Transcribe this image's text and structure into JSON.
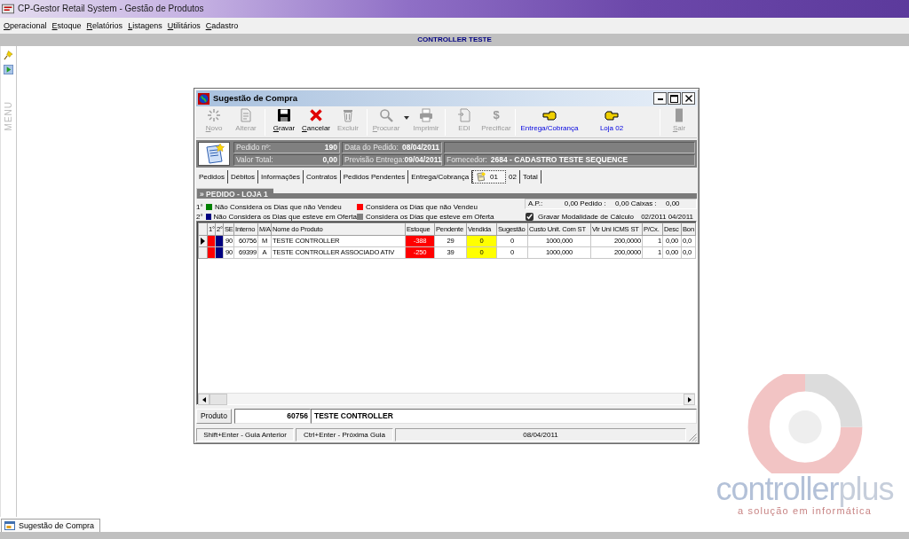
{
  "app": {
    "title": "CP-Gestor Retail System - Gestão de Produtos"
  },
  "menu": [
    "Operacional",
    "Estoque",
    "Relatórios",
    "Listagens",
    "Utilitários",
    "Cadastro"
  ],
  "banner": {
    "text": "CONTROLLER TESTE"
  },
  "sidebar": {
    "label": "MENU"
  },
  "dialog": {
    "title": "Sugestão de Compra",
    "toolbar_groups": [
      {
        "buttons": [
          {
            "label": "Novo",
            "kind": "new",
            "disabled": true,
            "mnemonic": true
          },
          {
            "label": "Alterar",
            "kind": "edit",
            "disabled": true,
            "mnemonic": false
          }
        ]
      },
      {
        "buttons": [
          {
            "label": "Gravar",
            "kind": "save",
            "disabled": false,
            "mnemonic": true
          },
          {
            "label": "Cancelar",
            "kind": "cancel",
            "disabled": false,
            "mnemonic": true
          },
          {
            "label": "Excluir",
            "kind": "delete",
            "disabled": true,
            "mnemonic": false
          }
        ]
      },
      {
        "buttons": [
          {
            "label": "Procurar",
            "kind": "search",
            "disabled": true,
            "mnemonic": true,
            "dropdown": true
          },
          {
            "label": "Imprimir",
            "kind": "print",
            "disabled": true,
            "mnemonic": false
          }
        ]
      },
      {
        "buttons": [
          {
            "label": "EDI",
            "kind": "edi",
            "disabled": true,
            "mnemonic": false
          },
          {
            "label": "Precificar",
            "kind": "price",
            "glyph": "$",
            "disabled": true,
            "mnemonic": false
          }
        ]
      },
      {
        "buttons": [
          {
            "label": "Entrega/Cobrança",
            "kind": "back",
            "disabled": false,
            "mnemonic": false,
            "highlighted": true
          },
          {
            "label": "Loja 02",
            "kind": "forward",
            "disabled": false,
            "mnemonic": false,
            "highlighted": true
          }
        ]
      },
      {
        "buttons": [
          {
            "label": "Sair",
            "kind": "exit",
            "disabled": true,
            "mnemonic": true
          }
        ]
      }
    ],
    "header": {
      "order_label": "Pedido nº:",
      "order": "190",
      "date_label": "Data do Pedido:",
      "date": "08/04/2011",
      "total_label": "Valor Total:",
      "total": "0,00",
      "delivery_label": "Previsão Entrega:",
      "delivery": "09/04/2011",
      "supplier_label": "Fornecedor:",
      "supplier": "2684 - CADASTRO TESTE SEQUENCE"
    },
    "tabs": [
      {
        "label": "Pedidos",
        "selected": false
      },
      {
        "label": "Débitos",
        "selected": false
      },
      {
        "label": "Informações",
        "selected": false
      },
      {
        "label": "Contratos",
        "selected": false
      },
      {
        "label": "Pedidos Pendentes",
        "selected": false
      },
      {
        "label": "Entrega/Cobrança",
        "selected": false
      },
      {
        "label": "01",
        "selected": true
      },
      {
        "label": "02",
        "selected": false
      },
      {
        "label": "Total",
        "selected": false
      }
    ],
    "section": {
      "title": "» PEDIDO - LOJA 1"
    },
    "legend": [
      {
        "order": "1°",
        "items": [
          {
            "color": "#008000",
            "text": "Não Considera os Dias que não Vendeu"
          },
          {
            "color": "#ff0000",
            "text": "Considera os Dias que não Vendeu"
          }
        ]
      },
      {
        "order": "2°",
        "items": [
          {
            "color": "#000080",
            "text": "Não Considera os Dias que esteve em Oferta"
          },
          {
            "color": "#808080",
            "text": "Considera os Dias que esteve em Oferta"
          }
        ]
      }
    ],
    "totals": [
      {
        "label": "A.P.:",
        "value": "0,00"
      },
      {
        "label": "Pedido :",
        "value": "0,00"
      },
      {
        "label": "Caixas :",
        "value": "0,00"
      }
    ],
    "save_mode": {
      "label": "Gravar Modalidade de Cálculo",
      "checked": true
    },
    "period": "02/2011 04/2011",
    "grid": {
      "columns": [
        "1°",
        "2°",
        "SE",
        "Interno",
        "M/A",
        "Nome do Produto",
        "Estoque",
        "Pendente",
        "Vendida",
        "Sugestão",
        "Custo Unit. Com ST",
        "Vlr Uni ICMS ST",
        "P/Cx.",
        "Desc",
        "Bon"
      ],
      "rows": [
        {
          "current": true,
          "cells": [
            {
              "color": "#ff0000"
            },
            {
              "color": "#000080"
            },
            {
              "text": "90"
            },
            {
              "text": "60756"
            },
            {
              "text": "M"
            },
            {
              "text": "TESTE CONTROLLER"
            },
            {
              "text": "-388",
              "color": "#ff0000"
            },
            {
              "text": "29"
            },
            {
              "text": "0",
              "color": "#ffff00"
            },
            {
              "text": "0"
            },
            {
              "text": "1000,000"
            },
            {
              "text": "200,0000"
            },
            {
              "text": "1"
            },
            {
              "text": "0,00"
            },
            {
              "text": "0,0"
            }
          ]
        },
        {
          "current": false,
          "cells": [
            {
              "color": "#ff0000"
            },
            {
              "color": "#000080"
            },
            {
              "text": "90"
            },
            {
              "text": "69399"
            },
            {
              "text": "A"
            },
            {
              "text": "TESTE CONTROLLER ASSOCIADO ATIV"
            },
            {
              "text": "-250",
              "color": "#ff0000"
            },
            {
              "text": "39"
            },
            {
              "text": "0",
              "color": "#ffff00"
            },
            {
              "text": "0"
            },
            {
              "text": "1000,000"
            },
            {
              "text": "200,0000"
            },
            {
              "text": "1"
            },
            {
              "text": "0,00"
            },
            {
              "text": "0,0"
            }
          ]
        }
      ]
    },
    "product": {
      "label": "Produto",
      "code": "60756",
      "name": "TESTE CONTROLLER"
    },
    "status_bar": [
      "Shift+Enter - Guia Anterior",
      "Ctrl+Enter - Próxima Guia",
      "08/04/2011"
    ]
  },
  "taskbar": [
    {
      "label": "Sugestão de Compra"
    }
  ],
  "logo": {
    "word_1": "controller",
    "word_2": "plus",
    "tagline": "a solução em informática"
  }
}
